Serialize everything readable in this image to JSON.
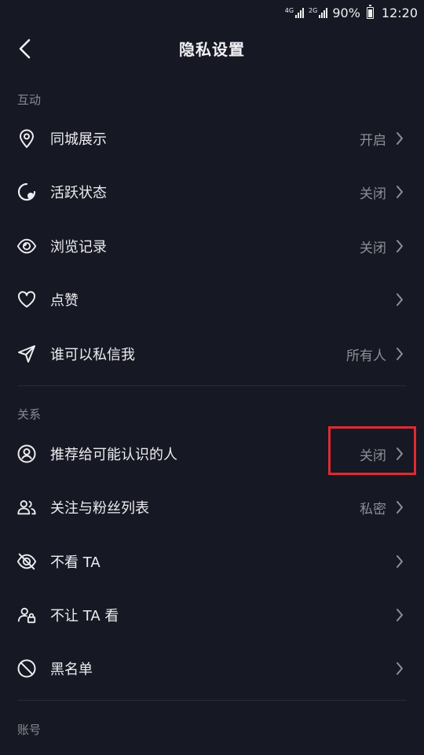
{
  "status_bar": {
    "network_top": "4G",
    "network_second": "2G",
    "battery": "90%",
    "battery_level": 0.9,
    "time": "12:20"
  },
  "header": {
    "title": "隐私设置",
    "back_icon": "chevron-left-icon"
  },
  "sections": {
    "interaction": {
      "title": "互动",
      "items": [
        {
          "label": "同城展示",
          "value": "开启",
          "icon": "location-pin-icon"
        },
        {
          "label": "活跃状态",
          "value": "关闭",
          "icon": "active-status-icon"
        },
        {
          "label": "浏览记录",
          "value": "关闭",
          "icon": "eye-icon"
        },
        {
          "label": "点赞",
          "value": "",
          "icon": "heart-icon"
        },
        {
          "label": "谁可以私信我",
          "value": "所有人",
          "icon": "send-icon"
        }
      ]
    },
    "relations": {
      "title": "关系",
      "items": [
        {
          "label": "推荐给可能认识的人",
          "value": "关闭",
          "icon": "user-circle-icon"
        },
        {
          "label": "关注与粉丝列表",
          "value": "私密",
          "icon": "users-icon"
        },
        {
          "label": "不看 TA",
          "value": "",
          "icon": "eye-off-icon"
        },
        {
          "label": "不让 TA 看",
          "value": "",
          "icon": "user-lock-icon"
        },
        {
          "label": "黑名单",
          "value": "",
          "icon": "block-icon"
        }
      ]
    },
    "account": {
      "title": "账号"
    }
  },
  "colors": {
    "background": "#161823",
    "text": "#ededf0",
    "secondary_text": "#8e8f95",
    "highlight": "#e02a33"
  }
}
